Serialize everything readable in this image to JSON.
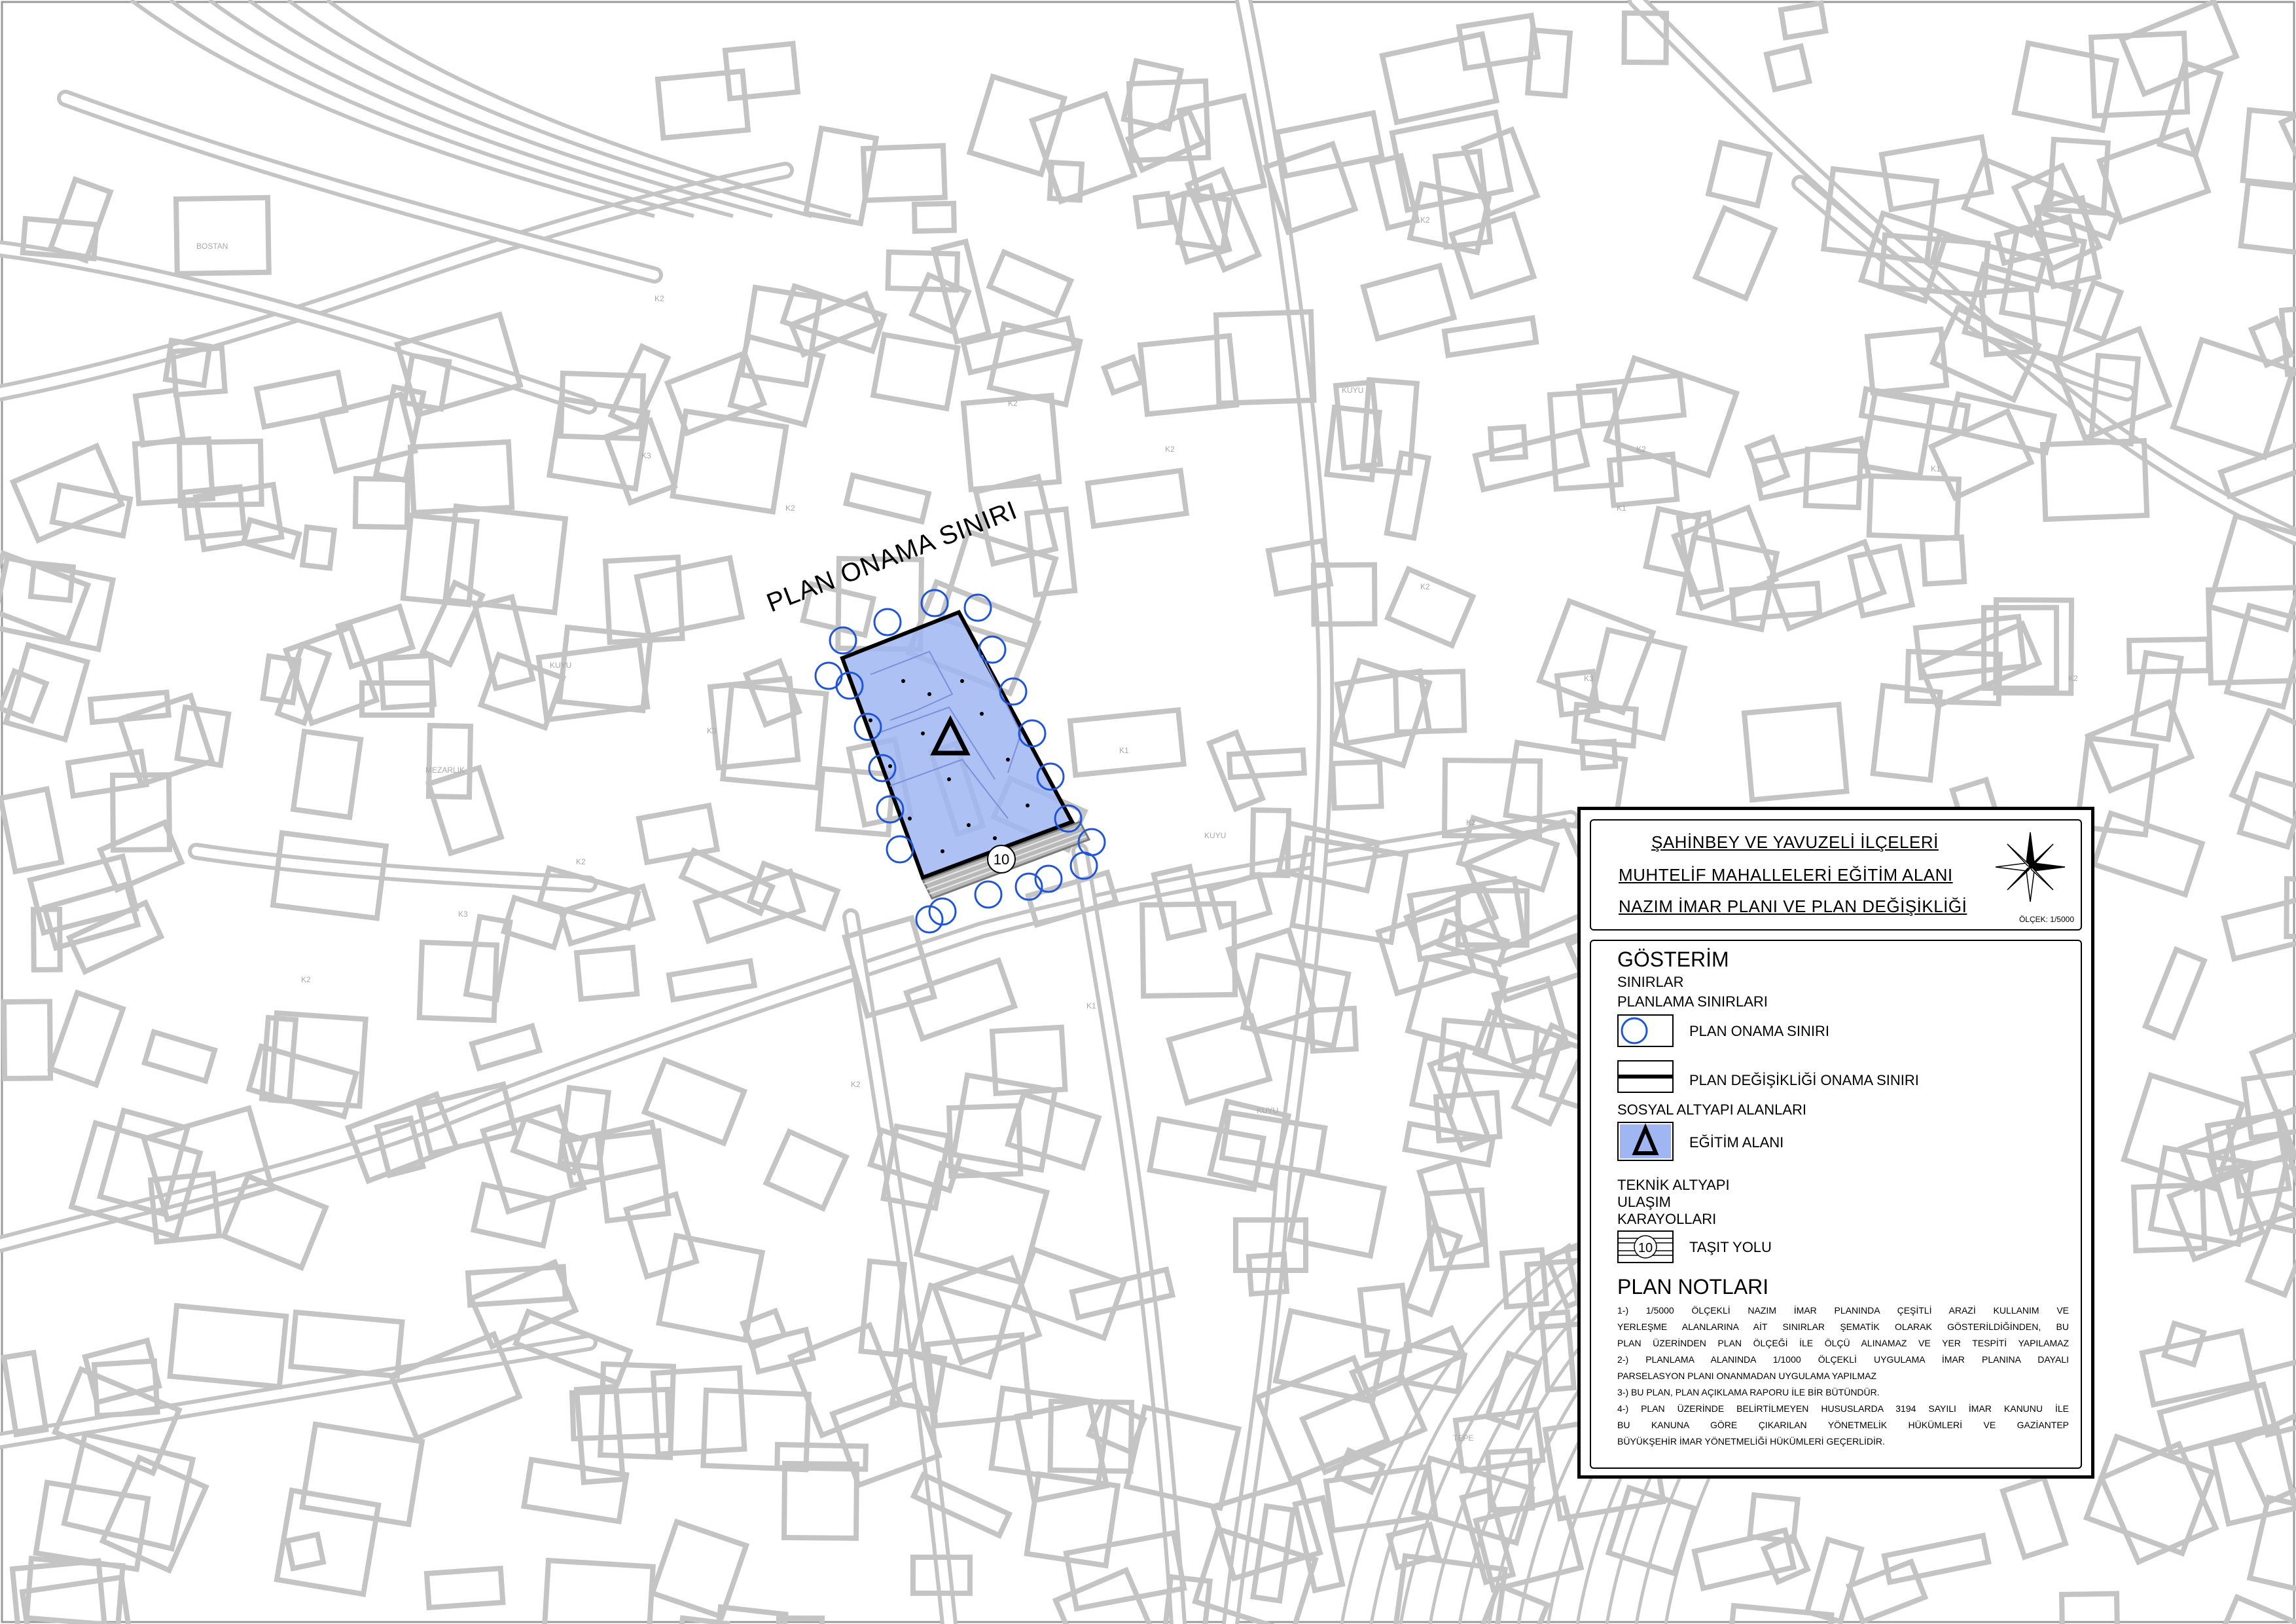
{
  "map": {
    "plan_onama_label": "PLAN ONAMA SINIRI",
    "road_number": "10",
    "labels": [
      {
        "text": "K2"
      },
      {
        "text": "K2"
      },
      {
        "text": "K3"
      },
      {
        "text": "K2"
      },
      {
        "text": "K2"
      },
      {
        "text": "K1"
      },
      {
        "text": "K2"
      },
      {
        "text": "K3"
      },
      {
        "text": "K2"
      },
      {
        "text": "K1"
      },
      {
        "text": "K2"
      },
      {
        "text": "K2"
      },
      {
        "text": "K3"
      },
      {
        "text": "K2"
      },
      {
        "text": "K1"
      },
      {
        "text": "K2"
      },
      {
        "text": "K2"
      },
      {
        "text": "K1"
      },
      {
        "text": "K2"
      },
      {
        "text": "K3"
      },
      {
        "text": "KUYU"
      },
      {
        "text": "KUYU"
      },
      {
        "text": "KUYU"
      },
      {
        "text": "KUYU"
      },
      {
        "text": "MEZARLIK"
      },
      {
        "text": "HARABE"
      },
      {
        "text": "HARABE"
      },
      {
        "text": "BOSTAN"
      },
      {
        "text": "TEPE"
      }
    ]
  },
  "title_block": {
    "line1": "ŞAHİNBEY VE YAVUZELİ İLÇELERİ",
    "line2": "MUHTELİF MAHALLELERİ EĞİTİM ALANI",
    "line3": "NAZIM İMAR PLANI VE PLAN DEĞİŞİKLİĞİ",
    "scale": "ÖLÇEK: 1/5000"
  },
  "legend": {
    "title": "GÖSTERİM",
    "sinirlar": "SINIRLAR",
    "planlama_sinirlari": "PLANLAMA SINIRLARI",
    "plan_onama_siniri": "PLAN ONAMA SINIRI",
    "plan_degisikligi_onama_siniri": "PLAN DEĞİŞİKLİĞİ ONAMA SINIRI",
    "sosyal_altyapi_alanlari": "SOSYAL ALTYAPI ALANLARI",
    "egitim_alani": "EĞİTİM ALANI",
    "teknik_altyapi": "TEKNİK ALTYAPI",
    "ulasim": "ULAŞIM",
    "karayollari": "KARAYOLLARI",
    "tasit_yolu": "TAŞIT YOLU",
    "tasit_yolu_number": "10",
    "plan_notlari_title": "PLAN NOTLARI",
    "notes": [
      "1-) 1/5000 ÖLÇEKLİ NAZIM İMAR PLANINDA ÇEŞİTLİ ARAZİ KULLANIM VE",
      "YERLEŞME ALANLARINA AİT SINIRLAR ŞEMATİK OLARAK GÖSTERİLDİĞİNDEN, BU",
      "PLAN ÜZERİNDEN PLAN ÖLÇEĞİ İLE ÖLÇÜ ALINAMAZ VE YER TESPİTİ YAPILAMAZ",
      "2-) PLANLAMA ALANINDA 1/1000 ÖLÇEKLİ UYGULAMA İMAR PLANINA DAYALI",
      "PARSELASYON PLANI ONANMADAN UYGULAMA YAPILMAZ",
      "3-) BU PLAN, PLAN AÇIKLAMA RAPORU İLE BİR BÜTÜNDÜR.",
      "4-) PLAN ÜZERİNDE BELİRTİLMEYEN HUSUSLARDA 3194 SAYILI İMAR KANUNU İLE",
      "BU KANUNA GÖRE ÇIKARILAN YÖNETMELİK HÜKÜMLERİ VE GAZİANTEP",
      "BÜYÜKŞEHİR İMAR YÖNETMELİĞİ HÜKÜMLERİ GEÇERLİDİR."
    ]
  },
  "colors": {
    "base_lines": "#c4c4c4",
    "education_fill": "#9fb6f2",
    "boundary_circles": "#1f55d6",
    "frame": "#000000"
  }
}
